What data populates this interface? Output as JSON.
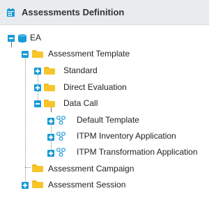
{
  "header": {
    "title": "Assessments Definition",
    "icon": "calendar-icon",
    "icon_color": "#1a9bd7"
  },
  "tree": {
    "root": {
      "label": "EA",
      "icon": "database-icon"
    },
    "assessment_template": {
      "label": "Assessment Template",
      "icon": "folder-icon"
    },
    "standard": {
      "label": "Standard",
      "icon": "folder-icon"
    },
    "direct_evaluation": {
      "label": "Direct Evaluation",
      "icon": "folder-icon"
    },
    "data_call": {
      "label": "Data Call",
      "icon": "folder-icon"
    },
    "default_template": {
      "label": "Default Template",
      "icon": "template-icon"
    },
    "itpm_inventory": {
      "label": "ITPM Inventory Application",
      "icon": "template-icon"
    },
    "itpm_transformation": {
      "label": "ITPM Transformation Application",
      "icon": "template-icon"
    },
    "assessment_campaign": {
      "label": "Assessment Campaign",
      "icon": "folder-icon"
    },
    "assessment_session": {
      "label": "Assessment Session",
      "icon": "folder-icon"
    }
  },
  "colors": {
    "accent": "#1a9bd7",
    "folder": "#f7c52c",
    "header_bg": "#e9ecef"
  }
}
